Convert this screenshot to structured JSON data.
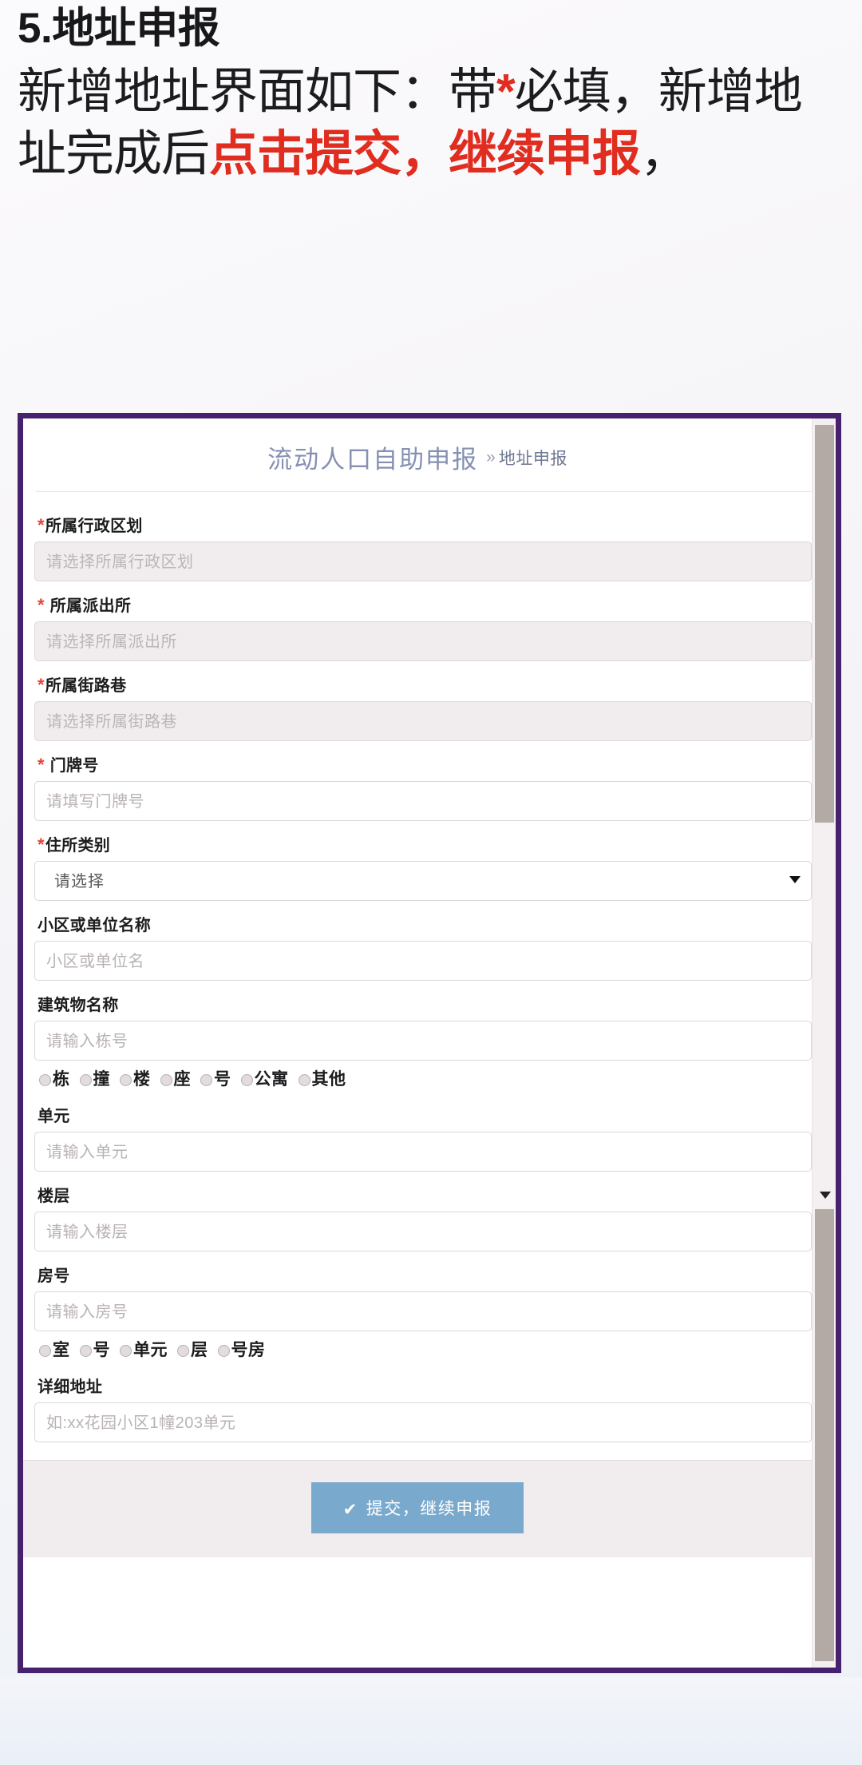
{
  "heading": {
    "number_title": "5.地址申报",
    "body_part1": "新增地址界面如下：带",
    "body_star": "*",
    "body_part2": "必填，新增地址完成后",
    "body_red1": "点击提交，继续申报",
    "body_part3": "，"
  },
  "app": {
    "title": "流动人口自助申报",
    "breadcrumb_sep": "»",
    "breadcrumb_current": "地址申报"
  },
  "form": {
    "fields": [
      {
        "label": "所属行政区划",
        "required": true,
        "type": "select-disabled",
        "placeholder": "请选择所属行政区划"
      },
      {
        "label": "所属派出所",
        "required": true,
        "type": "select-disabled",
        "placeholder": "请选择所属派出所"
      },
      {
        "label": "所属街路巷",
        "required": true,
        "type": "select-disabled",
        "placeholder": "请选择所属街路巷"
      },
      {
        "label": "门牌号",
        "required": true,
        "type": "text",
        "placeholder": "请填写门牌号"
      },
      {
        "label": "住所类别",
        "required": true,
        "type": "dropdown",
        "value": "请选择"
      },
      {
        "label": "小区或单位名称",
        "required": false,
        "type": "text",
        "placeholder": "小区或单位名"
      },
      {
        "label": "建筑物名称",
        "required": false,
        "type": "text",
        "placeholder": "请输入栋号",
        "radios": [
          "栋",
          "撞",
          "楼",
          "座",
          "号",
          "公寓",
          "其他"
        ]
      },
      {
        "label": "单元",
        "required": false,
        "type": "text",
        "placeholder": "请输入单元"
      },
      {
        "label": "楼层",
        "required": false,
        "type": "text",
        "placeholder": "请输入楼层"
      },
      {
        "label": "房号",
        "required": false,
        "type": "text",
        "placeholder": "请输入房号",
        "radios": [
          "室",
          "号",
          "单元",
          "层",
          "号房"
        ]
      },
      {
        "label": "详细地址",
        "required": false,
        "type": "text",
        "placeholder": "如:xx花园小区1幢203单元"
      }
    ],
    "submit_label": "提交，继续申报",
    "submit_check_icon": "✔"
  },
  "colors": {
    "panel_border": "#46216e",
    "accent_red": "#e02d20",
    "required_star": "#e8403a",
    "app_title": "#8590b2",
    "submit_bg": "#7aa9ce"
  }
}
